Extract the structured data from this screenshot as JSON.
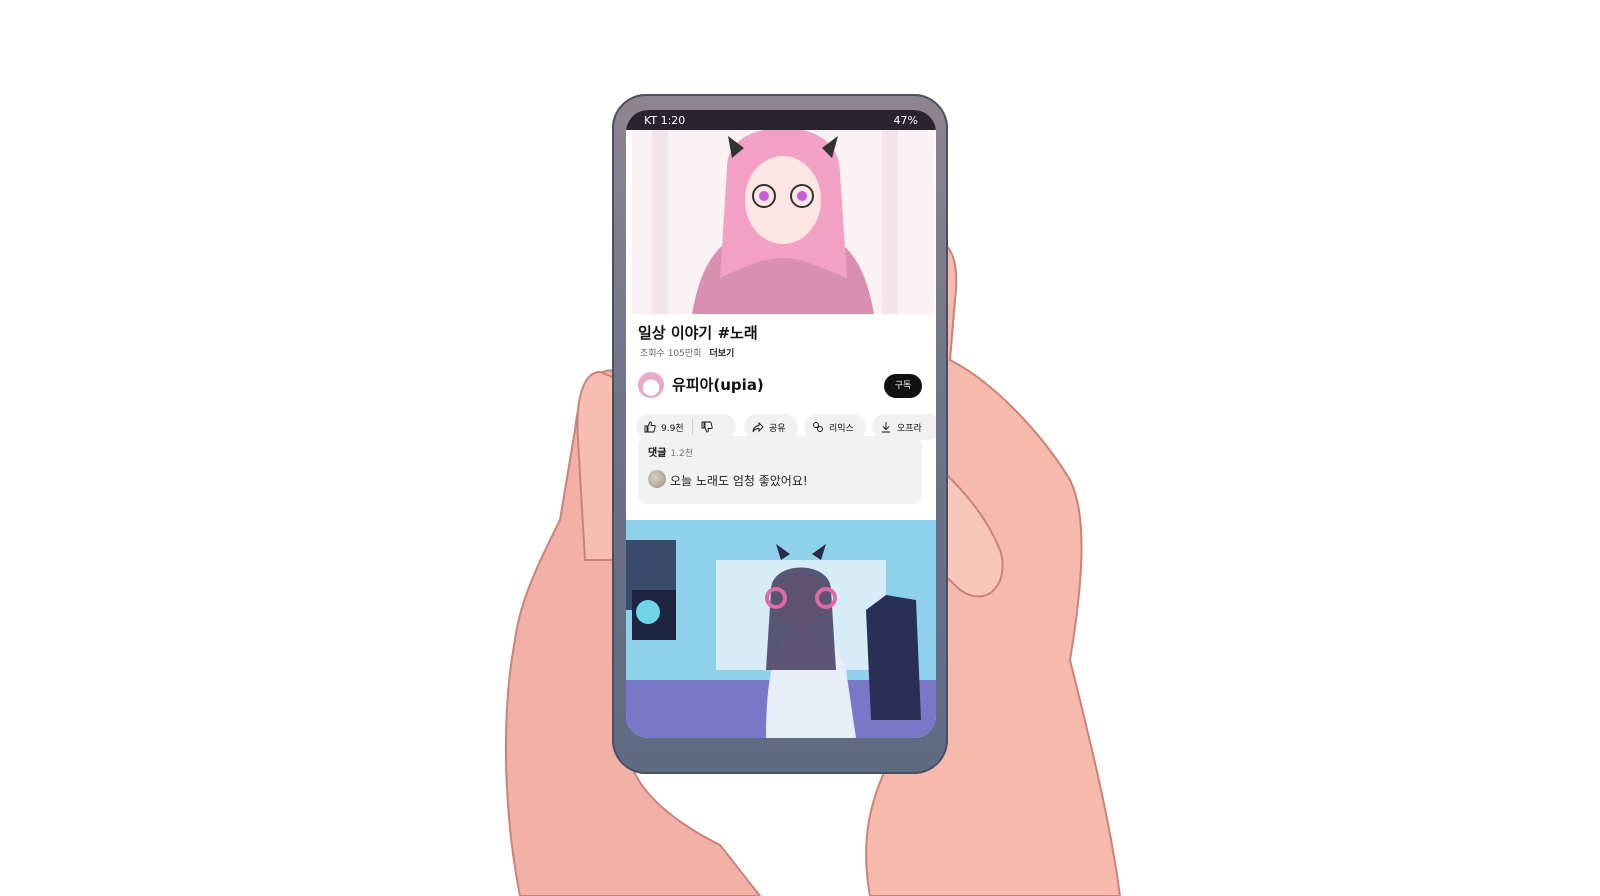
{
  "status_bar": {
    "carrier_time": "KT 1:20",
    "battery": "47%"
  },
  "video": {
    "title": "일상 이야기 #노래",
    "views": "조회수 105만회",
    "more": "더보기"
  },
  "channel": {
    "name": "유피아(upia)",
    "subscribe_label": "구독"
  },
  "actions": {
    "like_count": "9.9천",
    "share_label": "공유",
    "remix_label": "리믹스",
    "download_label": "오프라"
  },
  "comments": {
    "label": "댓글",
    "count": "1.2천",
    "top_comment": "오늘 노래도 엄청 좋았어요!"
  },
  "colors": {
    "subscribe_bg": "#111111",
    "pill_bg": "#f1f1f1",
    "phone_frame": "#6e7388",
    "skin": "#f2a99a"
  }
}
